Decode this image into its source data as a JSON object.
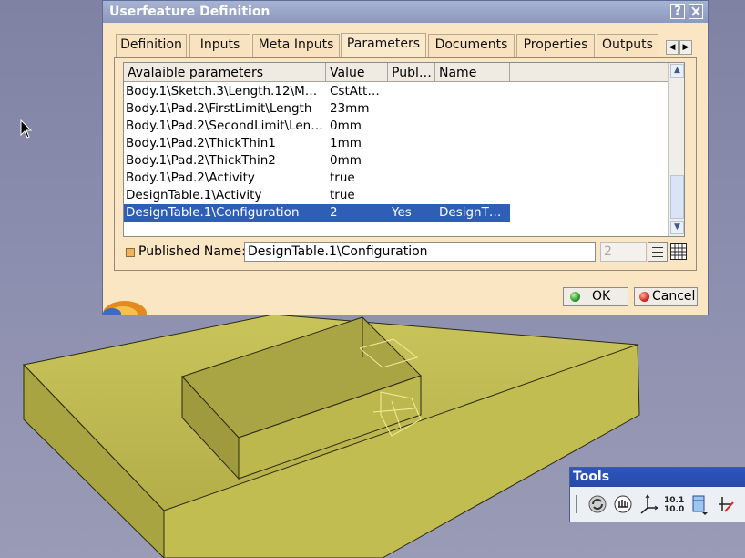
{
  "dialog": {
    "title": "Userfeature Definition",
    "help_label": "?",
    "tabs": [
      {
        "label": "Definition"
      },
      {
        "label": "Inputs"
      },
      {
        "label": "Meta Inputs"
      },
      {
        "label": "Parameters",
        "active": true
      },
      {
        "label": "Documents"
      },
      {
        "label": "Properties"
      },
      {
        "label": "Outputs"
      }
    ],
    "list": {
      "headers": [
        "Avalaible parameters",
        "Value",
        "Publ…",
        "Name"
      ],
      "rows": [
        {
          "param": "Body.1\\Sketch.3\\Length.12\\M…",
          "value": "CstAtt…",
          "published": "",
          "name": ""
        },
        {
          "param": "Body.1\\Pad.2\\FirstLimit\\Length",
          "value": "23mm",
          "published": "",
          "name": ""
        },
        {
          "param": "Body.1\\Pad.2\\SecondLimit\\Len…",
          "value": "0mm",
          "published": "",
          "name": ""
        },
        {
          "param": "Body.1\\Pad.2\\ThickThin1",
          "value": "1mm",
          "published": "",
          "name": ""
        },
        {
          "param": "Body.1\\Pad.2\\ThickThin2",
          "value": "0mm",
          "published": "",
          "name": ""
        },
        {
          "param": "Body.1\\Pad.2\\Activity",
          "value": "true",
          "published": "",
          "name": ""
        },
        {
          "param": "DesignTable.1\\Activity",
          "value": "true",
          "published": "",
          "name": ""
        },
        {
          "param": "DesignTable.1\\Configuration",
          "value": "2",
          "published": "Yes",
          "name": "DesignT…",
          "selected": true
        }
      ]
    },
    "published_name": {
      "label": "Published Name:",
      "value": "DesignTable.1\\Configuration",
      "spinner_value": "2"
    },
    "buttons": {
      "ok": "OK",
      "cancel": "Cancel"
    }
  },
  "tools_toolbar": {
    "title": "Tools",
    "icons": [
      "update-icon",
      "manipulate-icon",
      "axis-system-icon",
      "units-icon",
      "measure-icon",
      "snap-icon"
    ]
  },
  "colors": {
    "dialog_bg": "#fbe6c4",
    "title_bar": "#8c98bd",
    "selection": "#2f5eb7",
    "viewport_bg": "#8b8eae",
    "part_fill": "#b9b54a"
  }
}
